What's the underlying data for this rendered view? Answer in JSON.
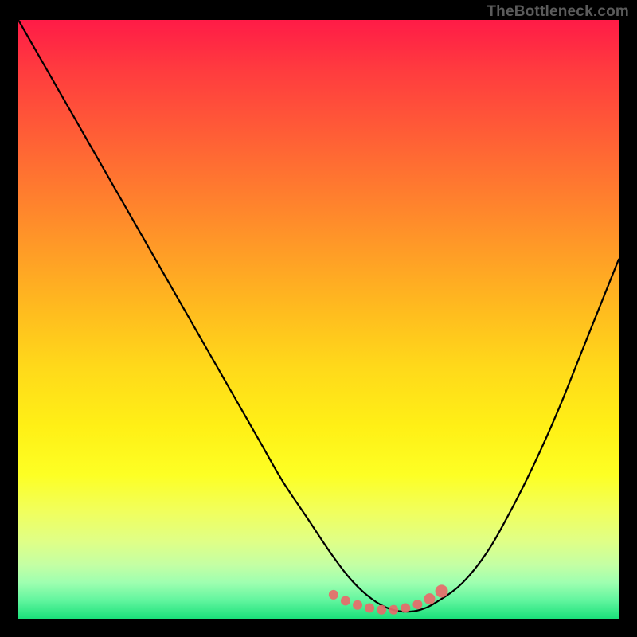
{
  "attribution": "TheBottleneck.com",
  "colors": {
    "curve": "#000000",
    "marker_fill": "#e86a6a",
    "marker_stroke": "#e86a6a"
  },
  "chart_data": {
    "type": "line",
    "title": "",
    "xlabel": "",
    "ylabel": "",
    "xlim": [
      0,
      100
    ],
    "ylim": [
      0,
      100
    ],
    "series": [
      {
        "name": "bottleneck-curve",
        "x": [
          0,
          4,
          8,
          12,
          16,
          20,
          24,
          28,
          32,
          36,
          40,
          44,
          48,
          52,
          55,
          58,
          61,
          64,
          67,
          70,
          74,
          78,
          82,
          86,
          90,
          94,
          98,
          100
        ],
        "y": [
          100,
          93,
          86,
          79,
          72,
          65,
          58,
          51,
          44,
          37,
          30,
          23,
          17,
          11,
          7,
          4,
          2,
          1.2,
          1.5,
          3,
          6,
          11,
          18,
          26,
          35,
          45,
          55,
          60
        ]
      }
    ],
    "markers": {
      "name": "highlighted-range",
      "x": [
        52.5,
        54.5,
        56.5,
        58.5,
        60.5,
        62.5,
        64.5,
        66.5,
        68.5,
        70.5
      ],
      "y": [
        4.0,
        3.0,
        2.3,
        1.8,
        1.5,
        1.5,
        1.8,
        2.4,
        3.3,
        4.6
      ],
      "r": [
        6,
        6,
        6,
        6,
        6,
        6,
        6,
        6,
        7,
        8
      ]
    }
  }
}
